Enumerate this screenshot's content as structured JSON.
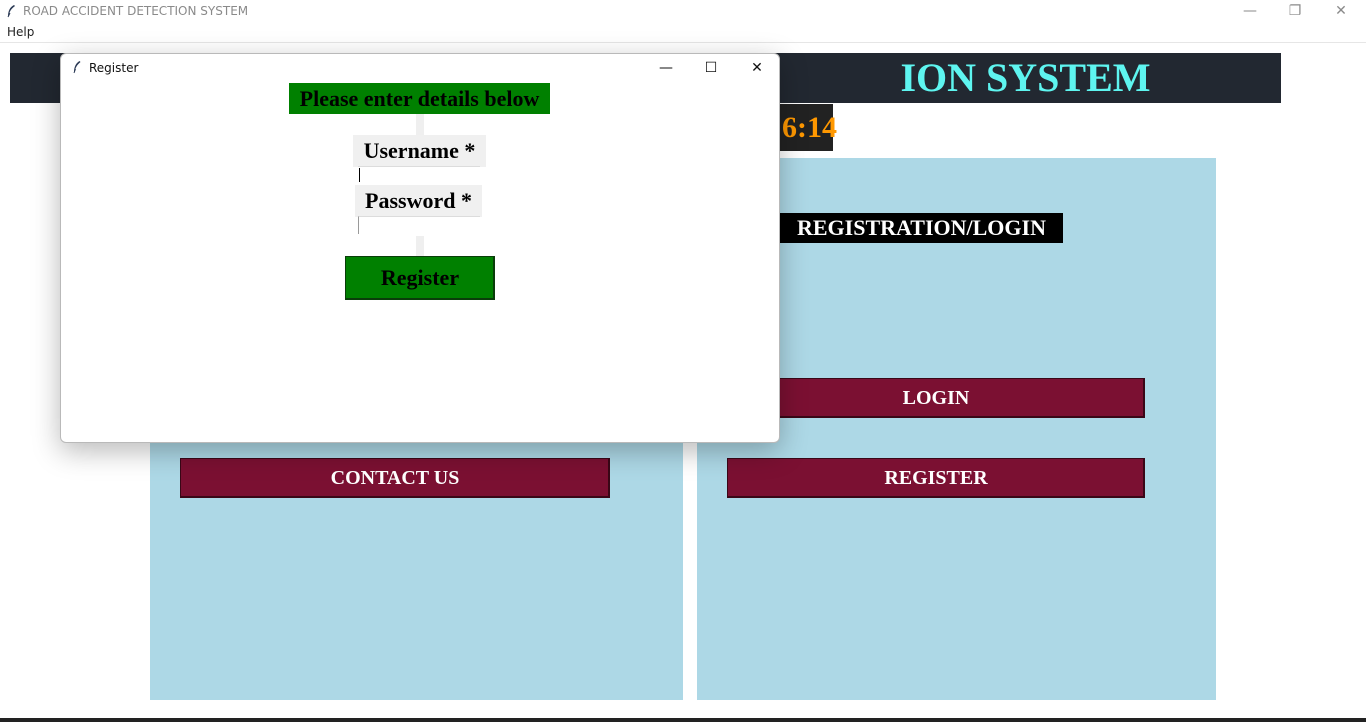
{
  "main_window": {
    "title": "ROAD ACCIDENT DETECTION SYSTEM",
    "menu": {
      "help": "Help"
    },
    "controls": {
      "minimize": "—",
      "restore": "❐",
      "close": "✕"
    }
  },
  "header": {
    "title_visible": "ION SYSTEM",
    "clock_visible": "6:14"
  },
  "right_panel": {
    "section_label": "REGISTRATION/LOGIN",
    "login_button": "LOGIN",
    "register_button": "REGISTER"
  },
  "left_panel": {
    "contact_button": "CONTACT US"
  },
  "dialog": {
    "title": "Register",
    "controls": {
      "minimize": "—",
      "maximize": "☐",
      "close": "✕"
    },
    "instruction": "Please enter details below",
    "username_label": "Username *",
    "username_value": "",
    "password_label": "Password *",
    "password_value": "",
    "submit_button": "Register"
  },
  "colors": {
    "header_bg": "#222831",
    "header_text": "#5ef5f0",
    "clock_text": "#ff9800",
    "panel_bg": "#add8e6",
    "maroon_button": "#7b1032",
    "green": "#008000"
  },
  "icons": {
    "app_icon": "feather-icon",
    "dialog_icon": "feather-icon"
  }
}
